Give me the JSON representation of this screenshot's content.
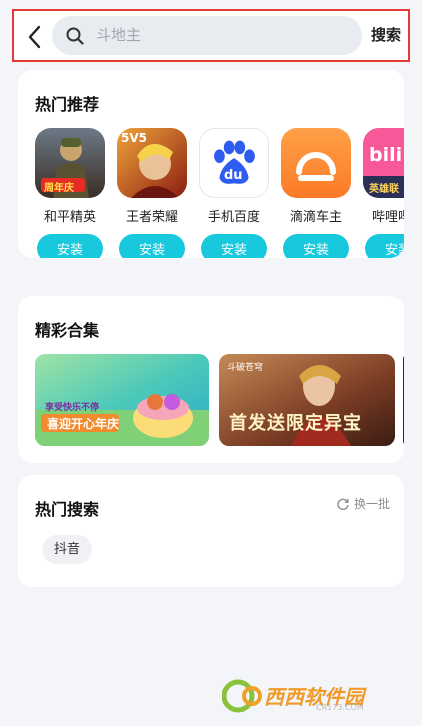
{
  "header": {
    "search_placeholder": "斗地主",
    "search_button": "搜索"
  },
  "recommend": {
    "title": "热门推荐",
    "install_label": "安装",
    "apps": [
      {
        "name": "和平精英",
        "icon": "peace-elite-icon",
        "badge": "周年庆"
      },
      {
        "name": "王者荣耀",
        "icon": "honor-of-kings-icon",
        "badge": "5V5"
      },
      {
        "name": "手机百度",
        "icon": "baidu-icon",
        "badge": "du"
      },
      {
        "name": "滴滴车主",
        "icon": "didi-icon"
      },
      {
        "name": "哔哩哔哩",
        "icon": "bilibili-icon",
        "badge": "bili",
        "badge2": "英雄联"
      }
    ]
  },
  "collections": {
    "title": "精彩合集",
    "banners": [
      {
        "text": "喜迎开心年庆",
        "top_text": "享受快乐不停"
      },
      {
        "text": "首发送限定异宝",
        "logo": "斗破苍穹"
      }
    ]
  },
  "hot_search": {
    "title": "热门搜索",
    "refresh_label": "换一批",
    "tags": [
      "抖音"
    ]
  },
  "watermark": {
    "text": "西西软件园",
    "sub": "CR173.COM"
  },
  "colors": {
    "accent": "#18c8dc",
    "highlight_border": "#e53935",
    "background": "#f3f5f9"
  }
}
